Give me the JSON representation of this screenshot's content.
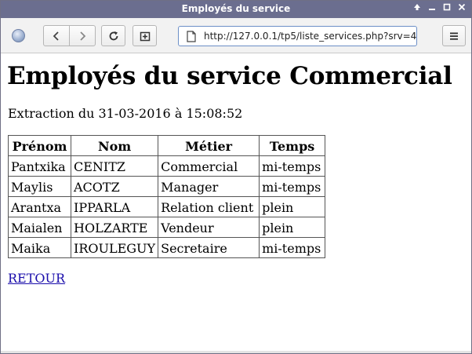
{
  "window": {
    "title": "Employés du service"
  },
  "toolbar": {
    "url": "http://127.0.0.1/tp5/liste_services.php?srv=4"
  },
  "page": {
    "heading": "Employés du service Commercial",
    "extraction": "Extraction du 31-03-2016 à 15:08:52",
    "table": {
      "headers": [
        "Prénom",
        "Nom",
        "Métier",
        "Temps"
      ],
      "rows": [
        [
          "Pantxika",
          "CENITZ",
          "Commercial",
          "mi-temps"
        ],
        [
          "Maylis",
          "ACOTZ",
          "Manager",
          "mi-temps"
        ],
        [
          "Arantxa",
          "IPPARLA",
          "Relation client",
          "plein"
        ],
        [
          "Maialen",
          "HOLZARTE",
          "Vendeur",
          "plein"
        ],
        [
          "Maika",
          "IROULEGUY",
          "Secretaire",
          "mi-temps"
        ]
      ]
    },
    "back_link": "RETOUR"
  },
  "icons": {
    "site": "globe-icon",
    "back": "chevron-left-icon",
    "forward": "chevron-right-icon",
    "reload": "reload-icon",
    "new_tab": "new-tab-icon",
    "page": "page-icon",
    "menu": "hamburger-menu-icon"
  },
  "colors": {
    "titlebar": "#6b6e8f",
    "link": "#1a0dab",
    "url_border": "#6c8fc7"
  }
}
